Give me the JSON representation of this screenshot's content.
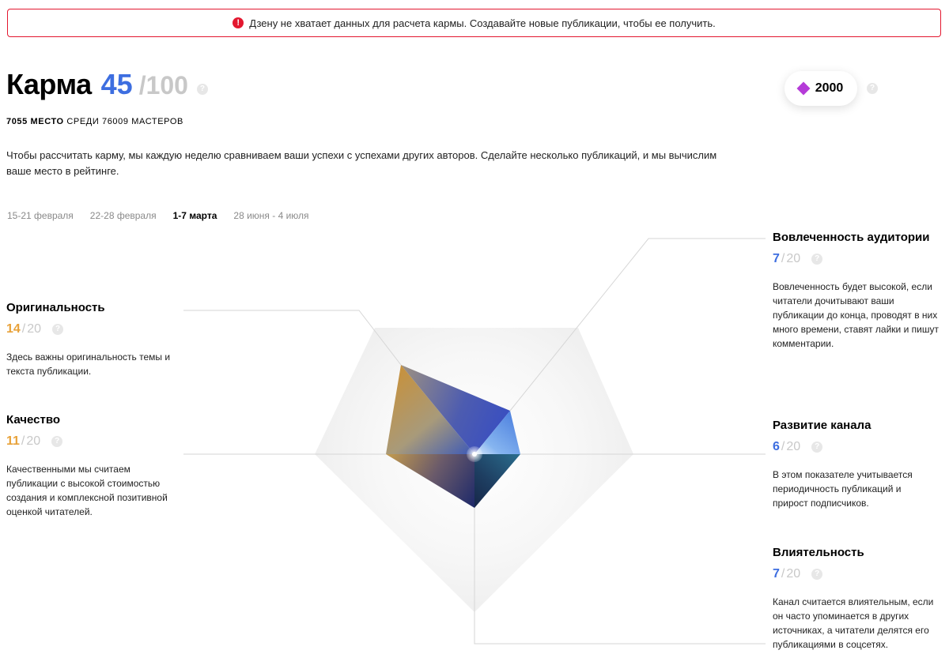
{
  "alert": {
    "icon": "exclamation-icon",
    "text": "Дзену не хватает данных для расчета кармы. Создавайте новые публикации, чтобы ее получить."
  },
  "karma": {
    "label": "Карма",
    "value": "45",
    "max": "/100",
    "help": "?"
  },
  "rank": {
    "place": "7055 МЕСТО",
    "rest": "СРЕДИ 76009 МАСТЕРОВ"
  },
  "description": "Чтобы рассчитать карму, мы каждую неделю сравниваем ваши успехи с успехами других авторов. Сделайте несколько публикаций, и мы вычислим ваше место в рейтинге.",
  "tabs": [
    {
      "label": "15-21 февраля",
      "active": false
    },
    {
      "label": "22-28 февраля",
      "active": false
    },
    {
      "label": "1-7 марта",
      "active": true
    },
    {
      "label": "28 июня - 4 июля",
      "active": false
    }
  ],
  "points": {
    "icon": "diamond-icon",
    "value": "2000",
    "help": "?"
  },
  "metrics": {
    "originality": {
      "title": "Оригинальность",
      "value": "14",
      "sep": "/",
      "max": "20",
      "help": "?",
      "description": "Здесь важны оригинальность темы и текста публикации."
    },
    "quality": {
      "title": "Качество",
      "value": "11",
      "sep": "/",
      "max": "20",
      "help": "?",
      "description": "Качественными мы считаем публикации с высокой стоимостью создания и комплексной позитивной оценкой читателей."
    },
    "engagement": {
      "title": "Вовлеченность аудитории",
      "value": "7",
      "sep": "/",
      "max": "20",
      "help": "?",
      "description": "Вовлеченность будет высокой, если читатели дочитывают ваши публикации до конца, проводят в них много времени, ставят лайки и пишут комментарии."
    },
    "growth": {
      "title": "Развитие канала",
      "value": "6",
      "sep": "/",
      "max": "20",
      "help": "?",
      "description": "В этом показателе учитывается периодичность публикаций и прирост подписчиков."
    },
    "influence": {
      "title": "Влиятельность",
      "value": "7",
      "sep": "/",
      "max": "20",
      "help": "?",
      "description": "Канал считается влиятельным, если он часто упоминается в других источниках, а читатели делятся его публикациями в соцсетях."
    }
  },
  "colors": {
    "accent_blue": "#3d6ee0",
    "accent_orange": "#e8a23a",
    "alert_red": "#e3172f",
    "points_purple": "#b53bd8"
  }
}
